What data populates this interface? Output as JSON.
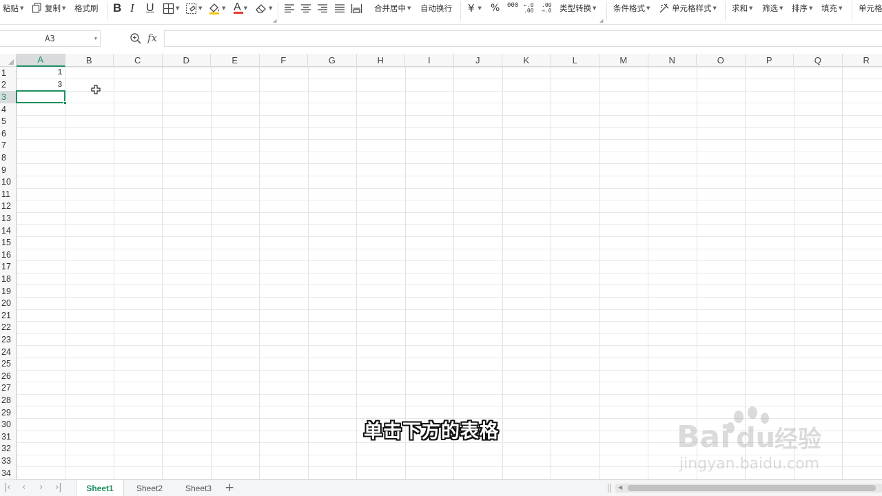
{
  "ribbon": {
    "paste": "粘贴",
    "copy": "复制",
    "format_painter": "格式刷",
    "merge_center": "合并居中",
    "wrap_text": "自动换行",
    "currency": "¥",
    "percent": "%",
    "thousands": "000",
    "inc_decimal": "←.0\n.00",
    "dec_decimal": ".00\n→.0",
    "type_convert": "类型转换",
    "cond_format": "条件格式",
    "cell_style": "单元格样式",
    "sum": "求和",
    "filter": "筛选",
    "sort": "排序",
    "fill": "填充",
    "cell": "单元格"
  },
  "formula_bar": {
    "name_box": "A3",
    "fx_label": "fx",
    "formula": ""
  },
  "columns": [
    "A",
    "B",
    "C",
    "D",
    "E",
    "F",
    "G",
    "H",
    "I",
    "J",
    "K",
    "L",
    "M",
    "N",
    "O",
    "P",
    "Q",
    "R"
  ],
  "rows": [
    "1",
    "2",
    "3",
    "4",
    "5",
    "6",
    "7",
    "8",
    "9",
    "10",
    "11",
    "12",
    "13",
    "14",
    "15",
    "16",
    "17",
    "18",
    "19",
    "20",
    "21",
    "22",
    "23",
    "24",
    "25",
    "26",
    "27",
    "28",
    "29",
    "30",
    "31",
    "32",
    "33",
    "34"
  ],
  "cells": {
    "A1": "1",
    "A2": "3"
  },
  "active_cell": "A3",
  "sheets": [
    "Sheet1",
    "Sheet2",
    "Sheet3"
  ],
  "active_sheet": "Sheet1",
  "overlay": {
    "subtitle": "单击下方的表格",
    "watermark_text": "Bai经验",
    "watermark_url": "jingyan.baidu.com"
  },
  "colors": {
    "accent": "#1e8f5e"
  }
}
